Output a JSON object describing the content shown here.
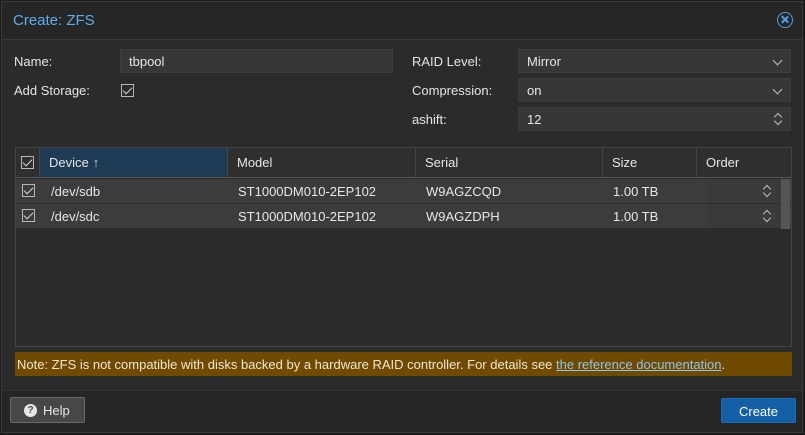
{
  "dialog": {
    "title": "Create: ZFS"
  },
  "form": {
    "name_label": "Name:",
    "name_value": "tbpool",
    "add_storage_label": "Add Storage:",
    "add_storage_checked": true,
    "raid_label": "RAID Level:",
    "raid_value": "Mirror",
    "compression_label": "Compression:",
    "compression_value": "on",
    "ashift_label": "ashift:",
    "ashift_value": "12"
  },
  "grid": {
    "columns": {
      "device": "Device",
      "model": "Model",
      "serial": "Serial",
      "size": "Size",
      "order": "Order"
    },
    "sort_indicator": "↑",
    "rows": [
      {
        "checked": true,
        "device": "/dev/sdb",
        "model": "ST1000DM010-2EP102",
        "serial": "W9AGZCQD",
        "size": "1.00 TB",
        "order": ""
      },
      {
        "checked": true,
        "device": "/dev/sdc",
        "model": "ST1000DM010-2EP102",
        "serial": "W9AGZDPH",
        "size": "1.00 TB",
        "order": ""
      }
    ]
  },
  "note": {
    "text": "Note: ZFS is not compatible with disks backed by a hardware RAID controller. For details see ",
    "link": "the reference documentation",
    "suffix": "."
  },
  "footer": {
    "help_label": "Help",
    "help_icon": "?",
    "create_label": "Create"
  },
  "colors": {
    "title": "#5eaef0",
    "primary_button": "#155fa6",
    "warning_bar": "#6f4a00",
    "sorted_header": "#1f3a55"
  },
  "icons": [
    "close-icon",
    "checkbox-icon",
    "chevron-down-icon",
    "spinner-icon",
    "help-icon",
    "sort-ascending-icon"
  ]
}
